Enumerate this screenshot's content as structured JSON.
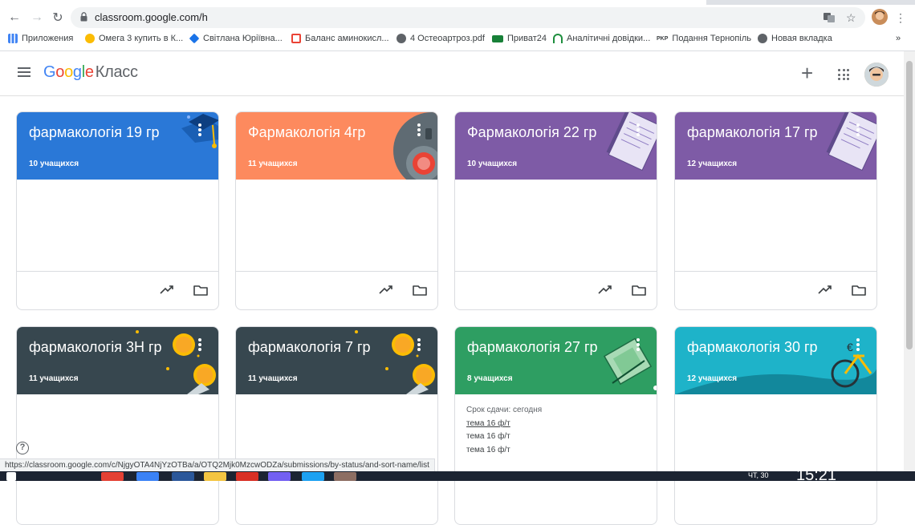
{
  "browser": {
    "url": "classroom.google.com/h",
    "bookmarks": [
      {
        "label": "Приложения",
        "color": "#4285f4"
      },
      {
        "label": "Омега 3 купить в К...",
        "color": "#fbbc04"
      },
      {
        "label": "Світлана Юріївна...",
        "color": "#1a73e8"
      },
      {
        "label": "Баланс аминокисл...",
        "color": "#ea4335"
      },
      {
        "label": "4 Остеоартроз.pdf",
        "color": "#5f6368"
      },
      {
        "label": "Приват24",
        "color": "#188038"
      },
      {
        "label": "Аналітичні довідки...",
        "color": "#1e8e3e"
      },
      {
        "label": "Подання Тернопіль",
        "color": "#202124"
      },
      {
        "label": "Новая вкладка",
        "color": "#5f6368"
      }
    ],
    "bookmarks_more": "»",
    "pkp_badge": "PKP"
  },
  "header": {
    "logo_google": "Google",
    "logo_product": "Класс",
    "add_label": "+",
    "google_letters": [
      "G",
      "o",
      "o",
      "g",
      "l",
      "e"
    ],
    "google_colors": [
      "#4285f4",
      "#ea4335",
      "#fbbc04",
      "#4285f4",
      "#34a853",
      "#ea4335"
    ]
  },
  "classes": [
    {
      "title": "фармакологія 19 гр",
      "students": "10 учащихся",
      "color": "#2a78d7",
      "theme": "cap"
    },
    {
      "title": "Фармакологія 4гр",
      "students": "11 учащихся",
      "color": "#fd8a5e",
      "theme": "lab"
    },
    {
      "title": "Фармакологія 22 гр",
      "students": "10 учащихся",
      "color": "#7e5ba6",
      "theme": "notebook"
    },
    {
      "title": "фармакологія 17 гр",
      "students": "12 учащихся",
      "color": "#7e5ba6",
      "theme": "notebook"
    },
    {
      "title": "фармакологія 3Н гр",
      "students": "11 учащихся",
      "color": "#37474f",
      "theme": "stars"
    },
    {
      "title": "фармакологія 7 гр",
      "students": "11 учащихся",
      "color": "#37474f",
      "theme": "stars"
    },
    {
      "title": "фармакологія 27 гр",
      "students": "8 учащихся",
      "color": "#2e9e62",
      "theme": "book",
      "due_label": "Срок сдачи: сегодня",
      "assignments": [
        "тема 16 ф/т",
        "тема 16 ф/т",
        "тема 16 ф/т"
      ]
    },
    {
      "title": "фармакологія 30 гр",
      "students": "12 учащихся",
      "color": "#1eb3c9",
      "theme": "bike"
    }
  ],
  "help_label": "?",
  "status_url": "https://classroom.google.com/c/NjgyOTA4NjYzOTBa/a/OTQ2Mjk0MzcwODZa/submissions/by-status/and-sort-name/list",
  "taskbar": {
    "day": "ЧТ, 30",
    "time": "15:21"
  }
}
